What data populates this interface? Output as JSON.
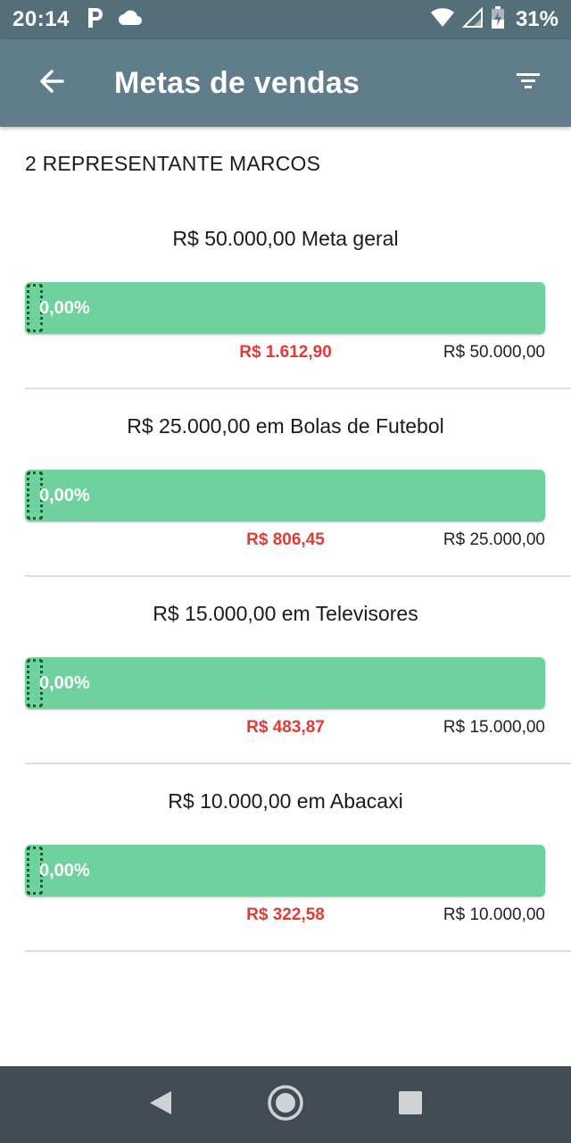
{
  "status_bar": {
    "time": "20:14",
    "left_icons": [
      "parking-icon",
      "cloud-icon"
    ],
    "right_icons": [
      "wifi-icon",
      "signal-icon",
      "battery-charging-icon"
    ],
    "battery": "31%"
  },
  "app_bar": {
    "title": "Metas de vendas",
    "back_icon": "arrow-back-icon",
    "filter_icon": "filter-list-icon"
  },
  "representative": "2 REPRESENTANTE MARCOS",
  "goals": [
    {
      "title": "R$ 50.000,00 Meta geral",
      "progress_label": "0,00%",
      "progress": 0.0,
      "achieved": "R$ 1.612,90",
      "target": "R$ 50.000,00"
    },
    {
      "title": "R$ 25.000,00 em Bolas de Futebol",
      "progress_label": "0,00%",
      "progress": 0.0,
      "achieved": "R$ 806,45",
      "target": "R$ 25.000,00"
    },
    {
      "title": "R$ 15.000,00 em Televisores",
      "progress_label": "0,00%",
      "progress": 0.0,
      "achieved": "R$ 483,87",
      "target": "R$ 15.000,00"
    },
    {
      "title": "R$ 10.000,00 em Abacaxi",
      "progress_label": "0,00%",
      "progress": 0.0,
      "achieved": "R$ 322,58",
      "target": "R$ 10.000,00"
    }
  ],
  "colors": {
    "status_bar": "#546e7a",
    "app_bar": "#607d8b",
    "progress_track": "#6fd19e",
    "achieved_text": "#e53935",
    "nav_bar": "#424b53"
  },
  "nav_bar": {
    "icons": [
      "back-triangle-icon",
      "home-circle-icon",
      "recents-square-icon"
    ]
  }
}
